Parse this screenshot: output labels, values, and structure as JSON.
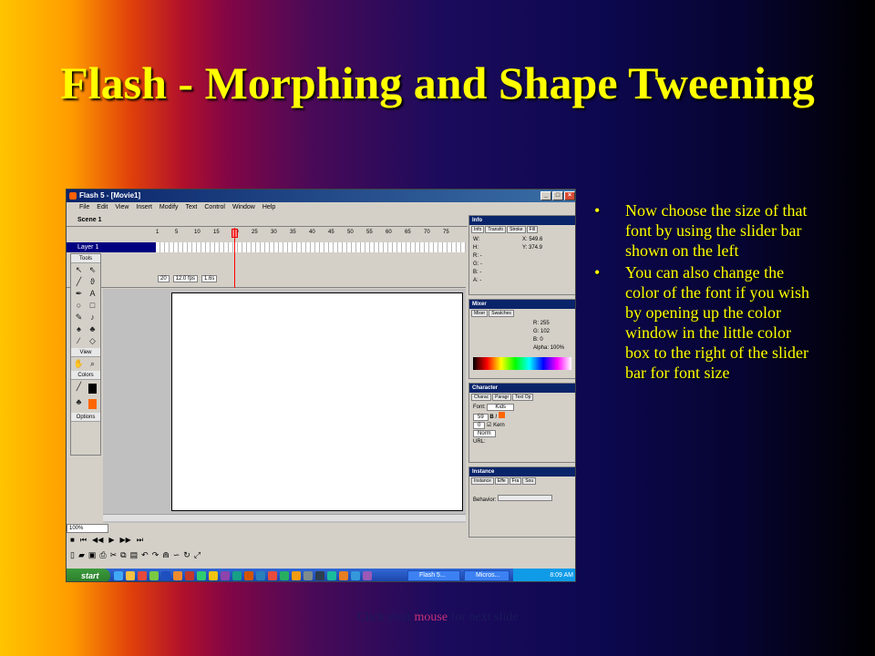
{
  "slide": {
    "title": "Flash - Morphing and Shape Tweening",
    "bullets": [
      "Now choose the size of that font by using the slider bar shown on the left",
      "You can also change the color of the font if you wish by opening up the color window in the little color box to the right of the slider bar for font size"
    ],
    "bullet_glyph": "•",
    "footer": {
      "before": "Click your ",
      "highlight": "mouse",
      "after": " for next slide"
    }
  },
  "screenshot": {
    "window_title": "Flash 5 - [Movie1]",
    "menu": [
      "File",
      "Edit",
      "View",
      "Insert",
      "Modify",
      "Text",
      "Control",
      "Window",
      "Help"
    ],
    "scene": "Scene 1",
    "layer": "Layer 1",
    "ruler": [
      "1",
      "5",
      "10",
      "15",
      "20",
      "25",
      "30",
      "35",
      "40",
      "45",
      "50",
      "55",
      "60",
      "65",
      "70",
      "75"
    ],
    "timeline_status": [
      "20",
      "12.0 fps",
      "1.6s"
    ],
    "tools_panel": {
      "title": "Tools",
      "view_label": "View",
      "colors_label": "Colors",
      "options_label": "Options"
    },
    "zoom": "100%",
    "panels": {
      "info": {
        "title": "Info",
        "tabs": [
          "Info",
          "Transfo",
          "Stroke",
          "Fill"
        ],
        "lines": [
          "W:",
          "H:",
          "R: -",
          "G: -",
          "B: -",
          "A: -",
          "X: 549.6",
          "Y: 374.9"
        ]
      },
      "mixer": {
        "title": "Mixer",
        "tabs": [
          "Mixer",
          "Swatches"
        ],
        "r": "R: 255",
        "g": "G: 102",
        "b": "B: 0",
        "alpha": "Alpha: 100%"
      },
      "character": {
        "title": "Character",
        "tabs": [
          "Charac",
          "Paragr",
          "Text Op"
        ],
        "font_label": "Font:",
        "font_value": "Kids",
        "size": "59",
        "tracking": "0",
        "baseline": "Norm",
        "kern": "Kern",
        "url": "URL:"
      },
      "instance": {
        "title": "Instance",
        "tabs": [
          "Instance",
          "Effe",
          "Fra",
          "Sou"
        ],
        "behavior": "Behavior:"
      }
    },
    "taskbar": {
      "start": "start",
      "items": [
        "Flash 5...",
        "Micros..."
      ],
      "clock": "8:09 AM"
    }
  }
}
